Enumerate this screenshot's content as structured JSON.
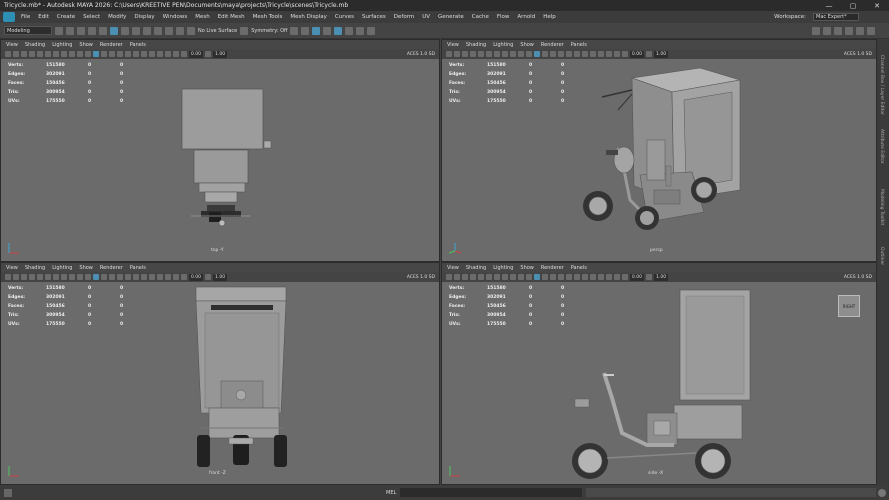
{
  "window": {
    "title": "Tricycle.mb* - Autodesk MAYA 2026: C:\\Users\\KREETIVE PEN\\Documents\\maya\\projects\\Tricycle\\scenes\\Tricycle.mb",
    "minimize": "—",
    "maximize": "▢",
    "close": "✕"
  },
  "menubar": {
    "items": [
      "File",
      "Edit",
      "Create",
      "Select",
      "Modify",
      "Display",
      "Windows",
      "Mesh",
      "Edit Mesh",
      "Mesh Tools",
      "Mesh Display",
      "Curves",
      "Surfaces",
      "Deform",
      "UV",
      "Generate",
      "Cache",
      "Flow",
      "Arnold",
      "Help"
    ],
    "workspace_label": "Workspace:",
    "workspace_value": "Mac Expert*"
  },
  "shelf": {
    "mode": "Modeling",
    "live_surface": "No Live Surface",
    "symmetry": "Symmetry: Off"
  },
  "panel_menu": [
    "View",
    "Shading",
    "Lighting",
    "Show",
    "Renderer",
    "Panels"
  ],
  "viewport_toolbar": {
    "value1": "0.00",
    "value2": "1.00",
    "color_space": "ACES 1.0 SD"
  },
  "hud": {
    "labels": [
      "Verts:",
      "Edges:",
      "Faces:",
      "Tris:",
      "UVs:"
    ],
    "values": [
      "151580",
      "302091",
      "150456",
      "300954",
      "175550"
    ],
    "col2": [
      "0",
      "0",
      "0",
      "0",
      "0"
    ],
    "col3": [
      "0",
      "0",
      "0",
      "0",
      "0"
    ]
  },
  "viewports": {
    "top": {
      "camera": "top -Y"
    },
    "persp": {
      "camera": "persp"
    },
    "front": {
      "camera": "front -Z"
    },
    "side": {
      "camera": "side -X"
    }
  },
  "view_cube_label": "RIGHT",
  "right_strip": [
    "Channel Box / Layer Editor",
    "Attribute Editor",
    "Modeling Toolkit",
    "Outliner"
  ],
  "command_line": {
    "label": "MEL"
  }
}
